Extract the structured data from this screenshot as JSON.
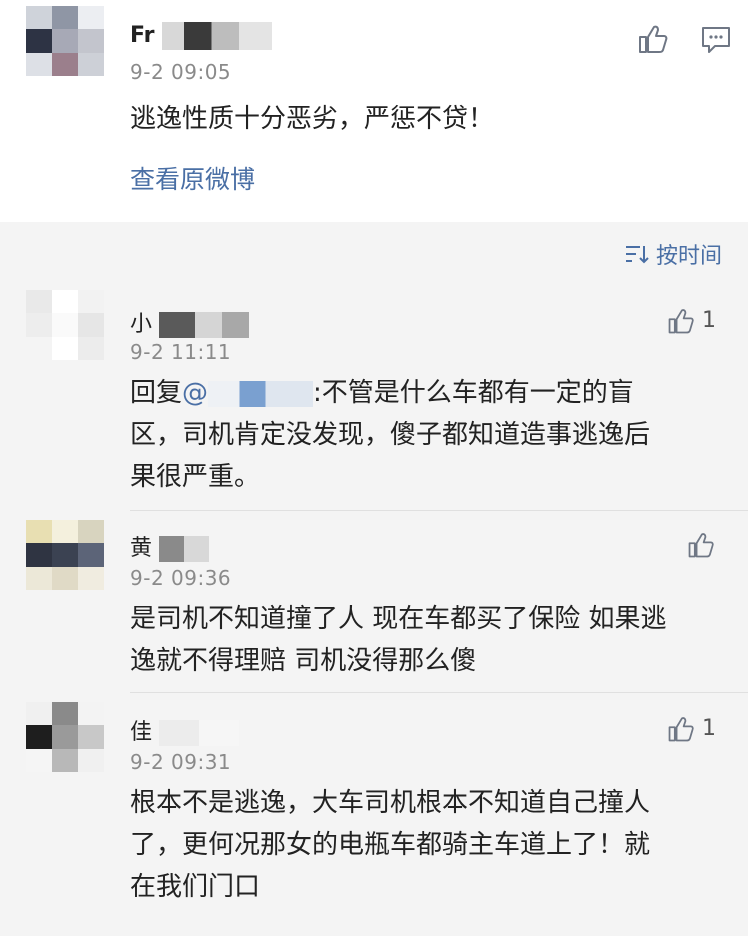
{
  "post": {
    "username": "Fr",
    "time": "9-2 09:05",
    "content": "逃逸性质十分恶劣，严惩不贷！",
    "view_original": "查看原微博"
  },
  "sort_label": "按时间",
  "comments": [
    {
      "username": "小",
      "time": "9-2 11:11",
      "likes": "1",
      "reply_prefix": "回复",
      "mention": "@",
      "line1": ":不管是什么车都有一定的盲",
      "line2": "区，司机肯定没发现，傻子都知道造事逃逸后",
      "line3": "果很严重。"
    },
    {
      "username": "黄",
      "time": "9-2 09:36",
      "likes": "",
      "line1": "是司机不知道撞了人 现在车都买了保险 如果逃",
      "line2": "逸就不得理赔 司机没得那么傻"
    },
    {
      "username": "佳",
      "time": "9-2 09:31",
      "likes": "1",
      "line1": "根本不是逃逸，大车司机根本不知道自己撞人",
      "line2": "了，更何况那女的电瓶车都骑主车道上了！就",
      "line3": "在我们门口"
    }
  ],
  "colors": {
    "link": "#4a6fa5",
    "text": "#222222",
    "meta": "#8a8a8a",
    "bg": "#f4f4f4"
  }
}
